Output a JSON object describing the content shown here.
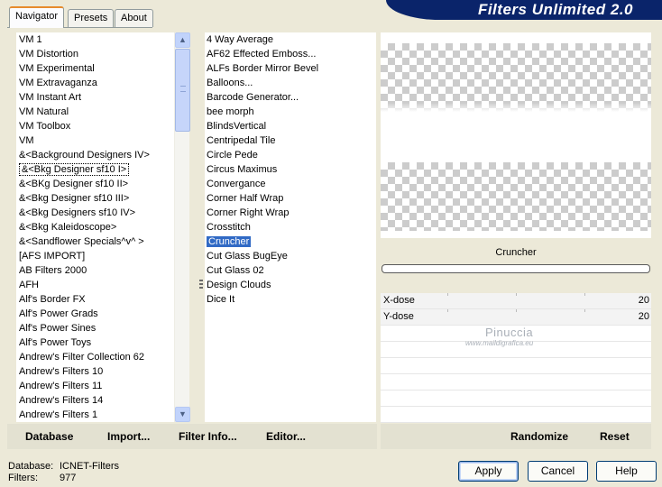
{
  "banner": {
    "title": "Filters Unlimited 2.0"
  },
  "tabs": [
    {
      "label": "Navigator",
      "active": true
    },
    {
      "label": "Presets",
      "active": false
    },
    {
      "label": "About",
      "active": false
    }
  ],
  "categories": [
    "VM 1",
    "VM Distortion",
    "VM Experimental",
    "VM Extravaganza",
    "VM Instant Art",
    "VM Natural",
    "VM Toolbox",
    "VM",
    "&<Background Designers IV>",
    "&<Bkg Designer sf10 I>",
    "&<BKg Designer sf10 II>",
    "&<Bkg Designer sf10 III>",
    "&<Bkg Designers sf10 IV>",
    "&<Bkg Kaleidoscope>",
    "&<Sandflower Specials^v^ >",
    "[AFS IMPORT]",
    "AB Filters 2000",
    "AFH",
    "Alf's Border FX",
    "Alf's Power Grads",
    "Alf's Power Sines",
    "Alf's Power Toys",
    "Andrew's Filter Collection 62",
    "Andrew's Filters 10",
    "Andrew's Filters 11",
    "Andrew's Filters 14",
    "Andrew's Filters 1"
  ],
  "selected_category": "&<Bkg Designer sf10 I>",
  "filters": [
    "4 Way Average",
    "AF62 Effected Emboss...",
    "ALFs Border Mirror Bevel",
    "Balloons...",
    "Barcode Generator...",
    "bee morph",
    "BlindsVertical",
    "Centripedal Tile",
    "Circle Pede",
    "Circus Maximus",
    "Convergance",
    "Corner Half Wrap",
    "Corner Right Wrap",
    "Crosstitch",
    "Cruncher",
    "Cut Glass  BugEye",
    "Cut Glass 02",
    "Design Clouds",
    "Dice It"
  ],
  "selected_filter": "Cruncher",
  "preview": {
    "filter_name": "Cruncher"
  },
  "params": [
    {
      "label": "X-dose",
      "value": "20"
    },
    {
      "label": "Y-dose",
      "value": "20"
    }
  ],
  "watermark": {
    "name": "Pinuccia",
    "url": "www.maildigrafica.eu"
  },
  "toolbar": {
    "database": "Database",
    "import": "Import...",
    "filter_info": "Filter Info...",
    "editor": "Editor...",
    "randomize": "Randomize",
    "reset": "Reset"
  },
  "status": {
    "database_label": "Database:",
    "database_value": "ICNET-Filters",
    "filters_label": "Filters:",
    "filters_value": "977"
  },
  "buttons": {
    "apply": "Apply",
    "cancel": "Cancel",
    "help": "Help"
  },
  "colors": {
    "banner": "#0a246a",
    "selection": "#316ac5",
    "dialog_bg": "#ece9d8"
  }
}
